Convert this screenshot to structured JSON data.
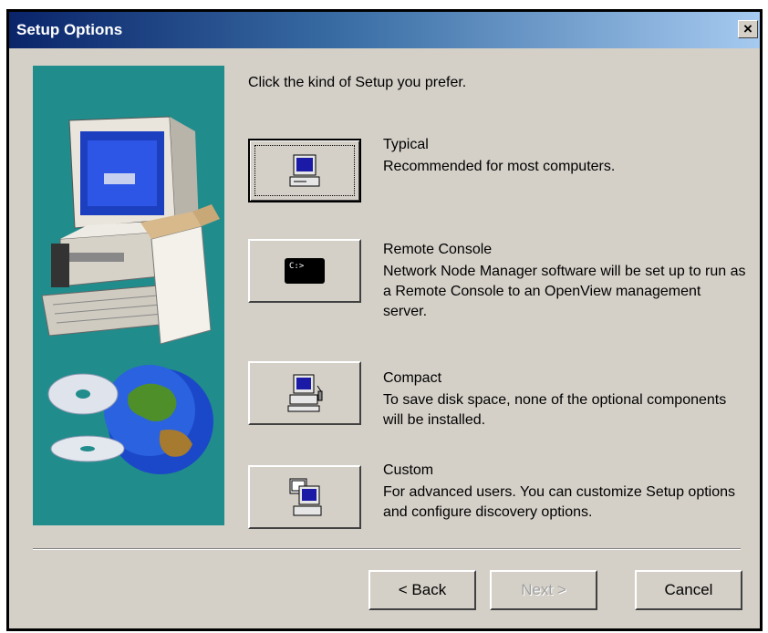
{
  "window": {
    "title": "Setup Options",
    "close_glyph": "×"
  },
  "prompt": "Click the kind of Setup you prefer.",
  "options": [
    {
      "title": "Typical",
      "description": "Recommended for most computers.",
      "icon": "monitor-icon",
      "focused": true
    },
    {
      "title": "Remote Console",
      "description": "Network Node Manager software will be set up to run as a Remote Console to an OpenView management server.",
      "icon": "console-icon",
      "focused": false
    },
    {
      "title": "Compact",
      "description": "To save disk space, none of the optional components will be installed.",
      "icon": "compact-computer-icon",
      "focused": false
    },
    {
      "title": "Custom",
      "description": "For advanced users.  You can customize Setup options and configure discovery options.",
      "icon": "custom-computer-icon",
      "focused": false
    }
  ],
  "buttons": {
    "back": "< Back",
    "next": "Next >",
    "next_enabled": false,
    "cancel": "Cancel"
  },
  "colors": {
    "title_start": "#0a246a",
    "title_end": "#a6caf0",
    "dialog_bg": "#d4d0c8",
    "art_bg": "#218c8c"
  }
}
